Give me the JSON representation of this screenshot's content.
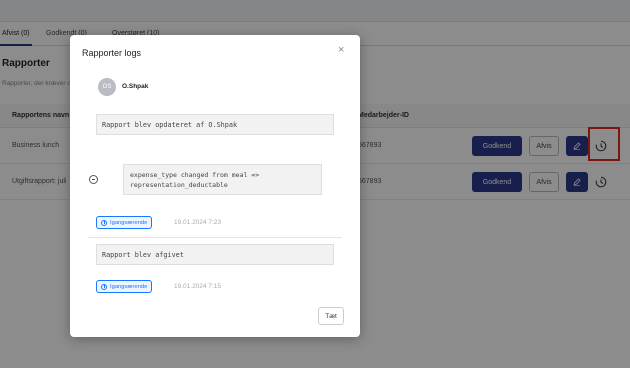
{
  "tabs": [
    "Afvist (0)",
    "Godkendt (0)",
    "Overstøret (10)"
  ],
  "page": {
    "title": "Rapporter",
    "subtitle": "Rapporter, der kræver din godkendelse"
  },
  "table": {
    "headers": [
      "Rapportens navn",
      "Medarbejder-ID"
    ],
    "rows": [
      {
        "name": "Business lunch",
        "employee_id": "567893"
      },
      {
        "name": "Utgiftsrapport: juli",
        "employee_id": "567893"
      }
    ],
    "actions": {
      "approve": "Godkend",
      "reject": "Afvis"
    }
  },
  "modal": {
    "title": "Rapporter logs",
    "user": {
      "initials": "OS",
      "name": "O.Shpak"
    },
    "entries": [
      {
        "message": "Rapport blev opdateret af O.Shpak"
      },
      {
        "detail_line1": "expense_type changed from meal =>",
        "detail_line2": "representation_deductable"
      },
      {
        "status": "Igangværende",
        "timestamp": "19.01.2024 7:23"
      },
      {
        "message": "Rapport blev afgivet"
      },
      {
        "status": "Igangværende",
        "timestamp": "19.01.2024 7:15"
      }
    ],
    "close_label": "Tæt",
    "close_icon": "×"
  },
  "colors": {
    "primary": "#2d3a8c",
    "status_blue": "#1677ff",
    "highlight": "#e0281e"
  }
}
